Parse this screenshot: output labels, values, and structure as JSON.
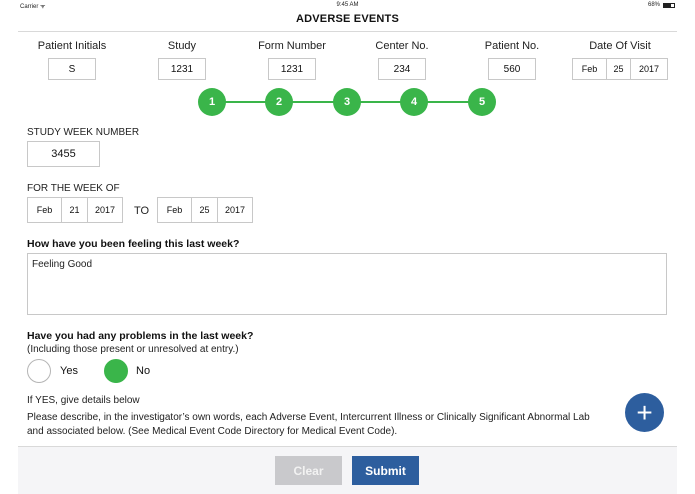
{
  "status_bar": {
    "carrier": "Carrier ᯤ",
    "time": "9:45 AM",
    "battery": "68%"
  },
  "nav": {
    "title": "ADVERSE EVENTS"
  },
  "header": {
    "patient_initials": {
      "label": "Patient Initials",
      "value": "S"
    },
    "study": {
      "label": "Study",
      "value": "1231"
    },
    "form_number": {
      "label": "Form Number",
      "value": "1231"
    },
    "center_no": {
      "label": "Center No.",
      "value": "234"
    },
    "patient_no": {
      "label": "Patient No.",
      "value": "560"
    },
    "date_of_visit": {
      "label": "Date Of Visit",
      "month": "Feb",
      "day": "25",
      "year": "2017"
    }
  },
  "stepper": {
    "steps": [
      "1",
      "2",
      "3",
      "4",
      "5"
    ],
    "color": "#3ab54a"
  },
  "study_week": {
    "label": "STUDY WEEK NUMBER",
    "value": "3455"
  },
  "week_of": {
    "label": "FOR THE WEEK OF",
    "from": {
      "month": "Feb",
      "day": "21",
      "year": "2017"
    },
    "to_label": "TO",
    "to": {
      "month": "Feb",
      "day": "25",
      "year": "2017"
    }
  },
  "feeling": {
    "question": "How have you been feeling this last week?",
    "value": "Feeling Good"
  },
  "problems": {
    "question": "Have you had any problems in the last week?",
    "note": "(Including those present or unresolved at entry.)",
    "yes_label": "Yes",
    "no_label": "No",
    "selected": "No"
  },
  "details": {
    "heading": "If YES, give details below",
    "line1": "Please describe, in the investigator’s own words, each Adverse Event, Intercurrent Illness or Clinically Significant Abnormal Lab",
    "line2": "and associated below. (See Medical Event Code Directory for Medical Event Code)."
  },
  "fab": {
    "icon": "plus-icon",
    "symbol": "+",
    "color": "#2d5e9e"
  },
  "footer": {
    "clear_label": "Clear",
    "submit_label": "Submit"
  }
}
